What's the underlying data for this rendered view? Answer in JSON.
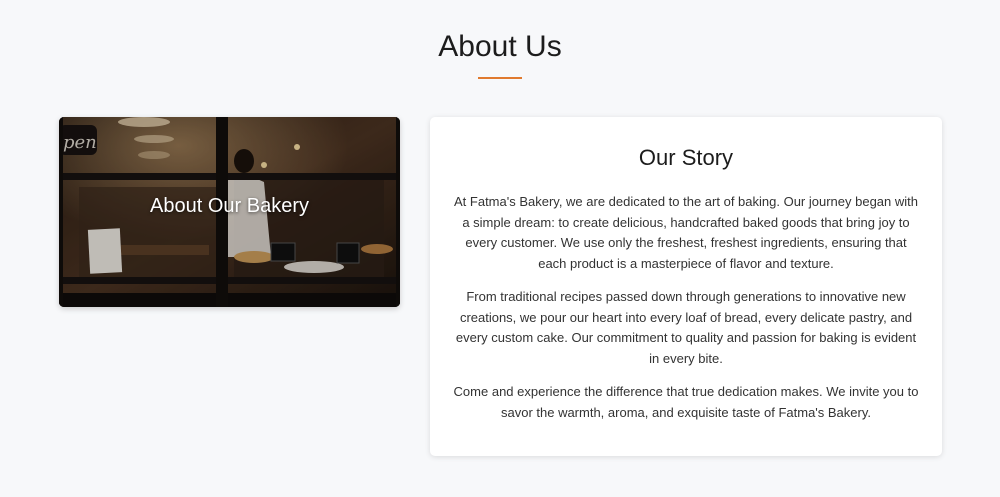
{
  "section": {
    "title": "About Us",
    "accent_color": "#e07a2e"
  },
  "image_card": {
    "caption": "About Our Bakery",
    "image_description_icon": "bakery-storefront-photo",
    "sign_text": "pen"
  },
  "story": {
    "title": "Our Story",
    "paragraphs": [
      "At Fatma's Bakery, we are dedicated to the art of baking. Our journey began with a simple dream: to create delicious, handcrafted baked goods that bring joy to every customer. We use only the freshest, freshest ingredients, ensuring that each product is a masterpiece of flavor and texture.",
      "From traditional recipes passed down through generations to innovative new creations, we pour our heart into every loaf of bread, every delicate pastry, and every custom cake. Our commitment to quality and passion for baking is evident in every bite.",
      "Come and experience the difference that true dedication makes. We invite you to savor the warmth, aroma, and exquisite taste of Fatma's Bakery."
    ]
  }
}
